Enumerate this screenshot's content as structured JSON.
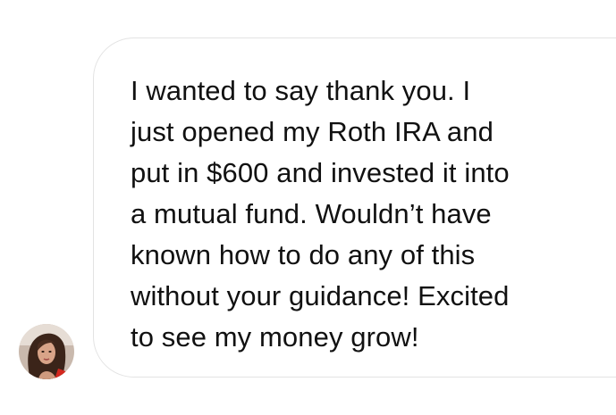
{
  "message": {
    "sender_avatar_icon": "user-avatar-photo",
    "lines": [
      "I wanted to say thank you. I",
      "just opened my Roth IRA and",
      "put in $600 and invested it into",
      "a mutual fund. Wouldn’t have",
      "known how to do any of this",
      "without your guidance! Excited",
      "to see my money grow!"
    ]
  },
  "colors": {
    "background": "#ffffff",
    "bubble_border": "#e3e3e3",
    "text": "#111111"
  }
}
